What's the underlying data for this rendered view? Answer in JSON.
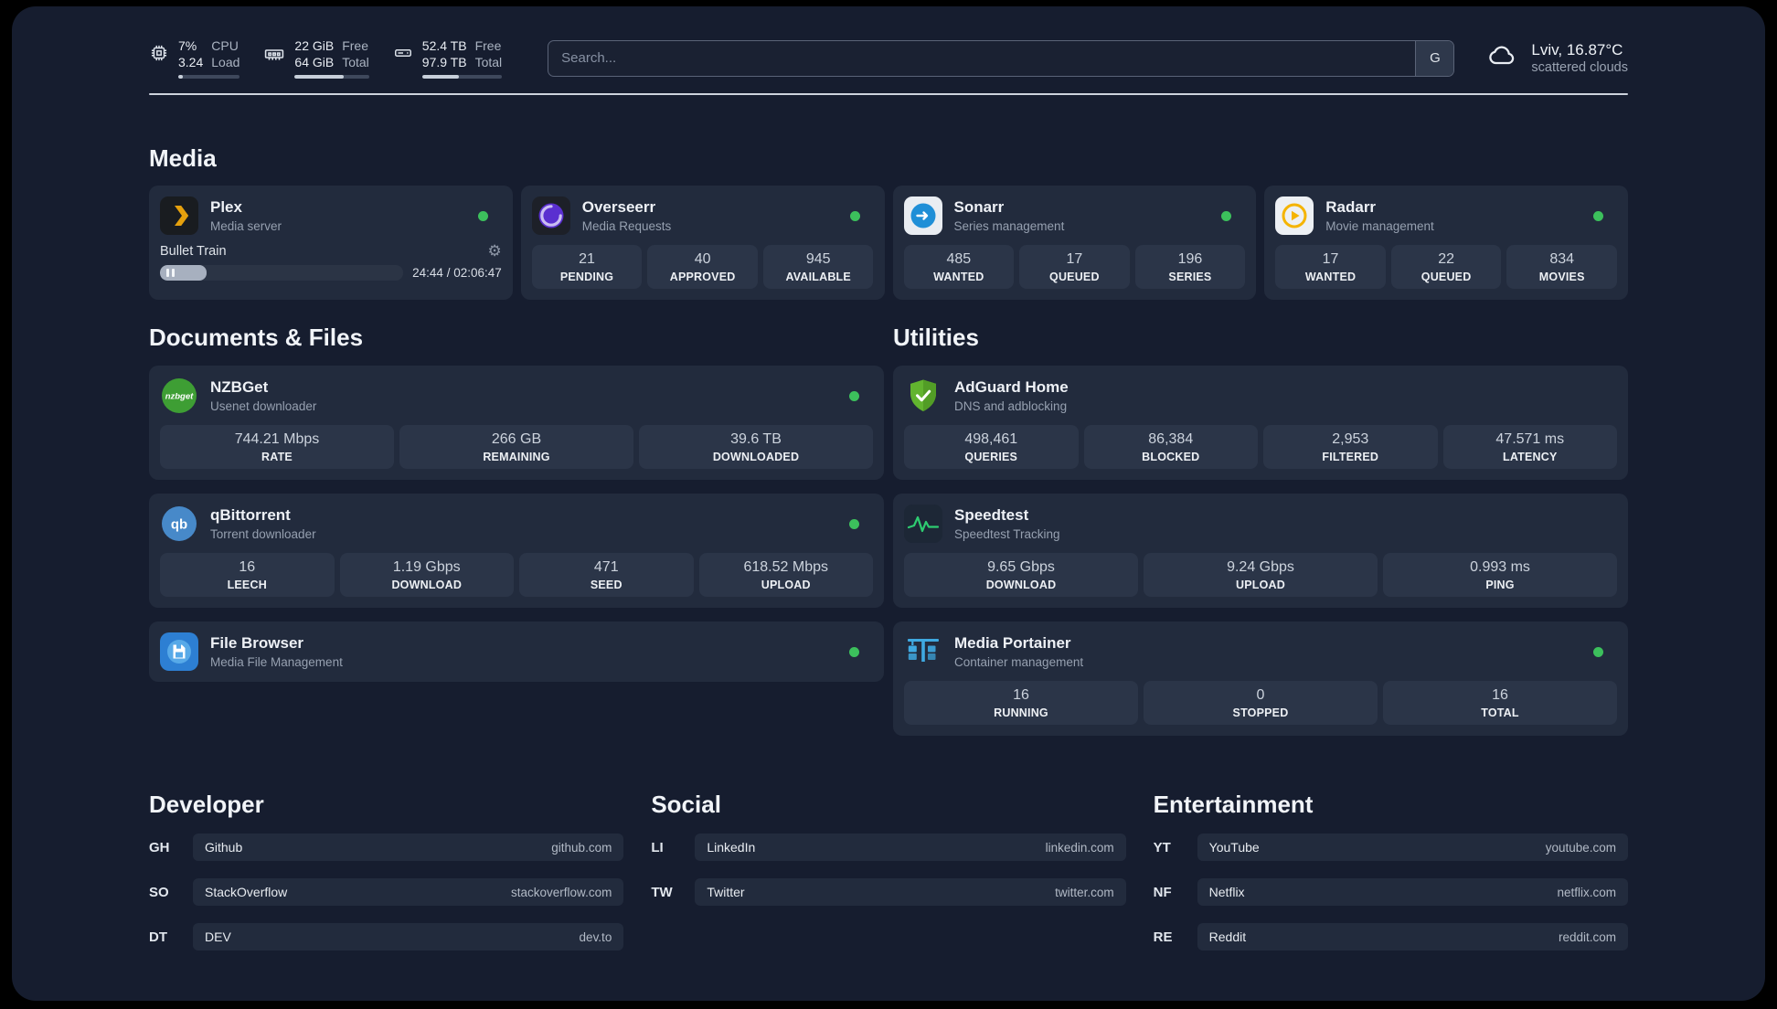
{
  "header": {
    "cpu": {
      "value_top": "7%",
      "value_bottom": "3.24",
      "label_top": "CPU",
      "label_bottom": "Load",
      "percent": 7
    },
    "ram": {
      "value_top": "22 GiB",
      "value_bottom": "64 GiB",
      "label_top": "Free",
      "label_bottom": "Total",
      "percent": 66
    },
    "disk": {
      "value_top": "52.4 TB",
      "value_bottom": "97.9 TB",
      "label_top": "Free",
      "label_bottom": "Total",
      "percent": 46
    },
    "search": {
      "placeholder": "Search...",
      "button_label": "G"
    },
    "weather": {
      "location": "Lviv, 16.87°C",
      "condition": "scattered clouds"
    }
  },
  "media": {
    "title": "Media",
    "plex": {
      "name": "Plex",
      "subtitle": "Media server",
      "now_playing": "Bullet Train",
      "time": "24:44 / 02:06:47",
      "progress_percent": 19
    },
    "overseerr": {
      "name": "Overseerr",
      "subtitle": "Media Requests",
      "stats": [
        {
          "value": "21",
          "label": "PENDING"
        },
        {
          "value": "40",
          "label": "APPROVED"
        },
        {
          "value": "945",
          "label": "AVAILABLE"
        }
      ]
    },
    "sonarr": {
      "name": "Sonarr",
      "subtitle": "Series management",
      "stats": [
        {
          "value": "485",
          "label": "WANTED"
        },
        {
          "value": "17",
          "label": "QUEUED"
        },
        {
          "value": "196",
          "label": "SERIES"
        }
      ]
    },
    "radarr": {
      "name": "Radarr",
      "subtitle": "Movie management",
      "stats": [
        {
          "value": "17",
          "label": "WANTED"
        },
        {
          "value": "22",
          "label": "QUEUED"
        },
        {
          "value": "834",
          "label": "MOVIES"
        }
      ]
    }
  },
  "documents": {
    "title": "Documents & Files",
    "nzbget": {
      "name": "NZBGet",
      "subtitle": "Usenet downloader",
      "stats": [
        {
          "value": "744.21 Mbps",
          "label": "RATE"
        },
        {
          "value": "266 GB",
          "label": "REMAINING"
        },
        {
          "value": "39.6 TB",
          "label": "DOWNLOADED"
        }
      ]
    },
    "qbittorrent": {
      "name": "qBittorrent",
      "subtitle": "Torrent downloader",
      "stats": [
        {
          "value": "16",
          "label": "LEECH"
        },
        {
          "value": "1.19 Gbps",
          "label": "DOWNLOAD"
        },
        {
          "value": "471",
          "label": "SEED"
        },
        {
          "value": "618.52 Mbps",
          "label": "UPLOAD"
        }
      ]
    },
    "filebrowser": {
      "name": "File Browser",
      "subtitle": "Media File Management"
    }
  },
  "utilities": {
    "title": "Utilities",
    "adguard": {
      "name": "AdGuard Home",
      "subtitle": "DNS and adblocking",
      "stats": [
        {
          "value": "498,461",
          "label": "QUERIES"
        },
        {
          "value": "86,384",
          "label": "BLOCKED"
        },
        {
          "value": "2,953",
          "label": "FILTERED"
        },
        {
          "value": "47.571 ms",
          "label": "LATENCY"
        }
      ]
    },
    "speedtest": {
      "name": "Speedtest",
      "subtitle": "Speedtest Tracking",
      "stats": [
        {
          "value": "9.65 Gbps",
          "label": "DOWNLOAD"
        },
        {
          "value": "9.24 Gbps",
          "label": "UPLOAD"
        },
        {
          "value": "0.993 ms",
          "label": "PING"
        }
      ]
    },
    "portainer": {
      "name": "Media Portainer",
      "subtitle": "Container management",
      "stats": [
        {
          "value": "16",
          "label": "RUNNING"
        },
        {
          "value": "0",
          "label": "STOPPED"
        },
        {
          "value": "16",
          "label": "TOTAL"
        }
      ]
    }
  },
  "links": {
    "developer": {
      "title": "Developer",
      "items": [
        {
          "abbr": "GH",
          "name": "Github",
          "domain": "github.com"
        },
        {
          "abbr": "SO",
          "name": "StackOverflow",
          "domain": "stackoverflow.com"
        },
        {
          "abbr": "DT",
          "name": "DEV",
          "domain": "dev.to"
        }
      ]
    },
    "social": {
      "title": "Social",
      "items": [
        {
          "abbr": "LI",
          "name": "LinkedIn",
          "domain": "linkedin.com"
        },
        {
          "abbr": "TW",
          "name": "Twitter",
          "domain": "twitter.com"
        }
      ]
    },
    "entertainment": {
      "title": "Entertainment",
      "items": [
        {
          "abbr": "YT",
          "name": "YouTube",
          "domain": "youtube.com"
        },
        {
          "abbr": "NF",
          "name": "Netflix",
          "domain": "netflix.com"
        },
        {
          "abbr": "RE",
          "name": "Reddit",
          "domain": "reddit.com"
        }
      ]
    }
  }
}
